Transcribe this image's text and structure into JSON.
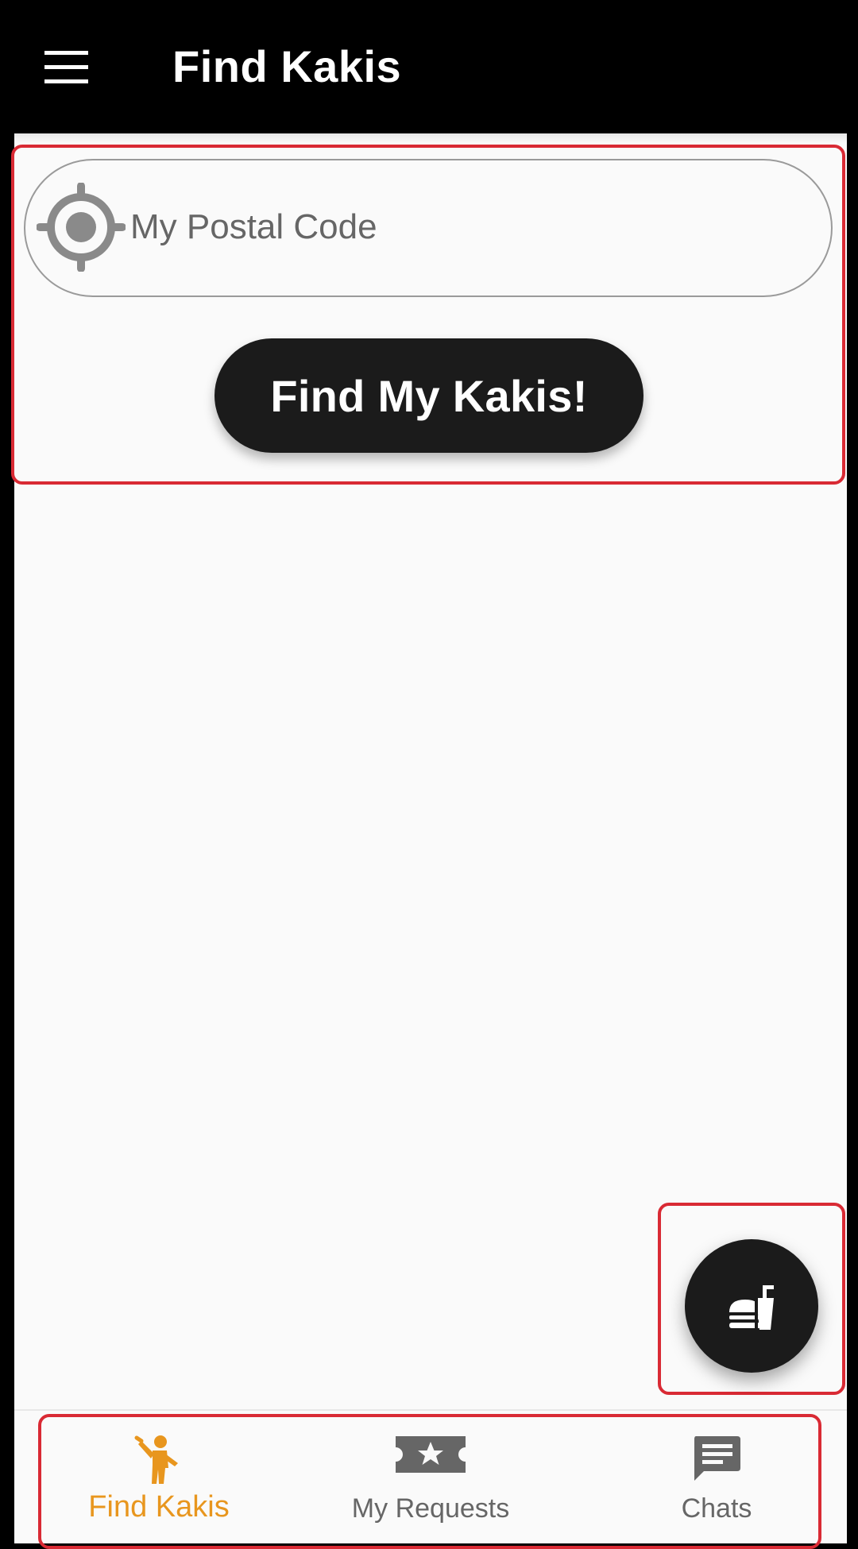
{
  "appbar": {
    "title": "Find Kakis",
    "menu_icon": "hamburger-menu-icon"
  },
  "search": {
    "placeholder": "My Postal Code",
    "value": "",
    "icon": "gps-target-icon",
    "button_label": "Find My Kakis!"
  },
  "fab": {
    "icon": "fastfood-icon"
  },
  "bottom_nav": {
    "items": [
      {
        "label": "Find Kakis",
        "icon": "person-waving-icon",
        "active": true
      },
      {
        "label": "My Requests",
        "icon": "ticket-star-icon",
        "active": false
      },
      {
        "label": "Chats",
        "icon": "chat-bubble-icon",
        "active": false
      }
    ]
  },
  "colors": {
    "appbar_bg": "#000000",
    "screen_bg": "#fafafa",
    "primary_dark": "#1b1b1b",
    "active_accent": "#e8961e",
    "inactive": "#666666",
    "highlight_frame": "#d92a34"
  }
}
